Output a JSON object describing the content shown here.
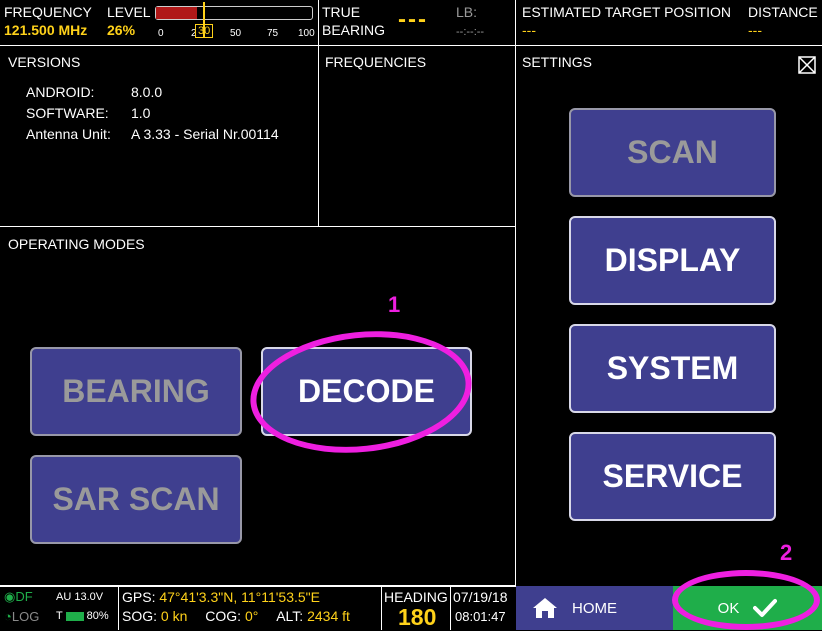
{
  "header": {
    "frequency_label": "FREQUENCY",
    "frequency_value": "121.500 MHz",
    "level_label": "LEVEL",
    "level_value": "26%",
    "level_fraction": 0.26,
    "level_threshold": "30",
    "level_ticks": [
      "0",
      "2",
      "50",
      "75",
      "100"
    ],
    "true_label": "TRUE",
    "bearing_label": "BEARING",
    "bearing_value": "---",
    "lb_label": "LB:",
    "lb_value": "--:--:--",
    "estimated_label": "ESTIMATED TARGET POSITION",
    "estimated_value": "---",
    "distance_label": "DISTANCE",
    "distance_value": "---"
  },
  "versions": {
    "title": "VERSIONS",
    "rows": [
      {
        "key": "ANDROID:",
        "value": "8.0.0"
      },
      {
        "key": "SOFTWARE:",
        "value": "1.0"
      },
      {
        "key": "Antenna Unit:",
        "value": "A 3.33 - Serial Nr.00114"
      }
    ]
  },
  "frequencies": {
    "title": "FREQUENCIES"
  },
  "operating_modes": {
    "title": "OPERATING MODES",
    "buttons": {
      "bearing": "BEARING",
      "decode": "DECODE",
      "sar_scan": "SAR SCAN"
    }
  },
  "settings": {
    "title": "SETTINGS",
    "buttons": {
      "scan": "SCAN",
      "display": "DISPLAY",
      "system": "SYSTEM",
      "service": "SERVICE"
    }
  },
  "annotations": {
    "one": "1",
    "two": "2"
  },
  "status": {
    "df_label": "DF",
    "au_voltage": "AU 13.0V",
    "log_label": "LOG",
    "battery_label": "T",
    "battery_value": "80%",
    "gps_label": "GPS:",
    "gps_value": "47°41'3.3\"N, 11°11'53.5\"E",
    "sog_label": "SOG:",
    "sog_value": "0 kn",
    "cog_label": "COG:",
    "cog_value": "0°",
    "alt_label": "ALT:",
    "alt_value": "2434 ft",
    "heading_label": "HEADING",
    "heading_value": "180",
    "date": "07/19/18",
    "time": "08:01:47"
  },
  "footer": {
    "home_label": "HOME",
    "ok_label": "OK"
  },
  "colors": {
    "accent_yellow": "#ffd21a",
    "button_blue": "#3f3f8f",
    "ok_green": "#1fae4a",
    "annotation_magenta": "#ee1fe0"
  }
}
